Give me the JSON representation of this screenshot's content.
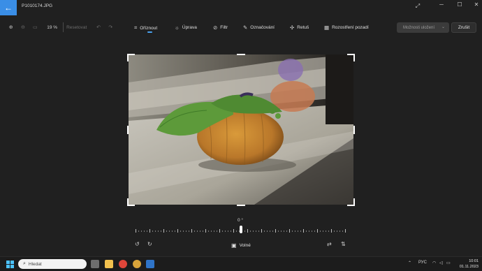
{
  "titlebar": {
    "file_name": "P1010174.JPG",
    "minimize": "─",
    "maximize": "☐",
    "close": "✕",
    "expand_icon": "expand-icon"
  },
  "toolbar": {
    "zoom_percent": "19 %",
    "reset_label": "Resetovat",
    "tools": [
      {
        "label": "Oříznout",
        "icon": "crop-icon",
        "active": true
      },
      {
        "label": "Úprava",
        "icon": "adjust-icon",
        "active": false
      },
      {
        "label": "Filtr",
        "icon": "filter-icon",
        "active": false
      },
      {
        "label": "Označování",
        "icon": "markup-icon",
        "active": false
      },
      {
        "label": "Retuš",
        "icon": "retouch-icon",
        "active": false
      },
      {
        "label": "Rozostření pozadí",
        "icon": "background-blur-icon",
        "active": false
      }
    ],
    "save_options": "Možnosti uložení",
    "cancel": "Zrušit"
  },
  "rotation": {
    "angle": "0 °",
    "aspect_ratio": "Volné"
  },
  "taskbar": {
    "search_placeholder": "Hledat",
    "language": "РУС",
    "time": "10:01",
    "date": "01.11.2023"
  },
  "colors": {
    "accent": "#4aa3f0",
    "background": "#202020",
    "back_button": "#3a8ee6"
  }
}
